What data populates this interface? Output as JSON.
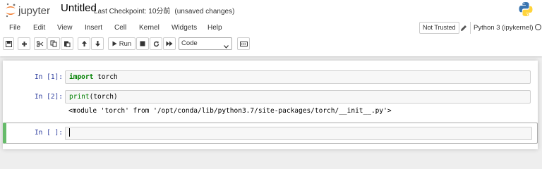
{
  "header": {
    "logo_text": "jupyter",
    "notebook_name": "Untitled",
    "checkpoint": "Last Checkpoint: 10分前",
    "autosave_status": "(unsaved changes)"
  },
  "menu": [
    "File",
    "Edit",
    "View",
    "Insert",
    "Cell",
    "Kernel",
    "Widgets",
    "Help"
  ],
  "trust_status": "Not Trusted",
  "kernel_name": "Python 3 (ipykernel)",
  "toolbar": {
    "run_label": "Run",
    "cell_type": "Code"
  },
  "cells": [
    {
      "prompt": "In [1]:",
      "keyword": "import",
      "rest": " torch"
    },
    {
      "prompt": "In [2]:",
      "builtin": "print",
      "rest": "(torch)",
      "output": "<module 'torch' from '/opt/conda/lib/python3.7/site-packages/torch/__init__.py'>"
    },
    {
      "prompt": "In [ ]:"
    }
  ],
  "colors": {
    "prompt": "#303f9f",
    "keyword": "#008000",
    "active_cell_bar": "#66bb6a",
    "logo_orange": "#f37726"
  }
}
